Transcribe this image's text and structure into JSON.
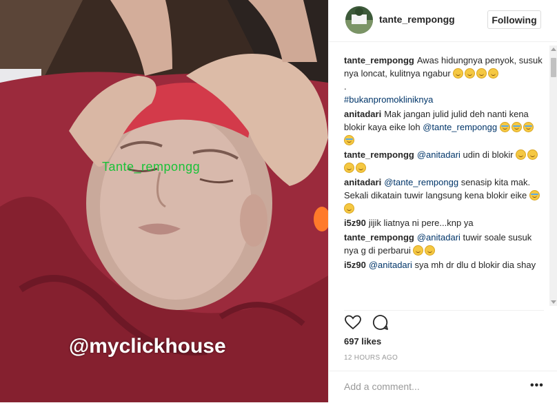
{
  "media": {
    "watermark_top": "Tante_rempongg",
    "watermark_bottom": "@myclickhouse"
  },
  "header": {
    "username": "tante_rempongg",
    "follow_label": "Following"
  },
  "caption": {
    "user": "tante_rempongg",
    "text": "Awas hidungnya penyok, susuk nya loncat, kulitnya ngabur",
    "dot": ".",
    "hashtag": "#bukanpromokliniknya"
  },
  "comments": [
    {
      "user": "anitadari",
      "text": "Mak jangan julid julid deh nanti kena blokir kaya eike loh",
      "mention": "@tante_rempongg"
    },
    {
      "user": "tante_rempongg",
      "mention": "@anitadari",
      "text": "udin di blokir"
    },
    {
      "user": "anitadari",
      "mention": "@tante_rempongg",
      "text": "senasip kita mak. Sekali dikatain tuwir langsung kena blokir eike"
    },
    {
      "user": "i5z90",
      "text": "jijik liatnya ni pere...knp ya"
    },
    {
      "user": "tante_rempongg",
      "mention": "@anitadari",
      "text": "tuwir soale susuk nya g di perbarui"
    },
    {
      "user": "i5z90",
      "mention": "@anitadari",
      "text": "sya mh dr dlu d blokir dia shay"
    }
  ],
  "actions": {
    "like_icon": "heart-icon",
    "comment_icon": "comment-bubble-icon"
  },
  "likes": "697 likes",
  "timestamp": "12 HOURS AGO",
  "add_comment": {
    "placeholder": "Add a comment...",
    "more_label": "•••"
  },
  "colors": {
    "link": "#003569",
    "border": "#efefef",
    "text": "#262626",
    "muted": "#999999"
  }
}
